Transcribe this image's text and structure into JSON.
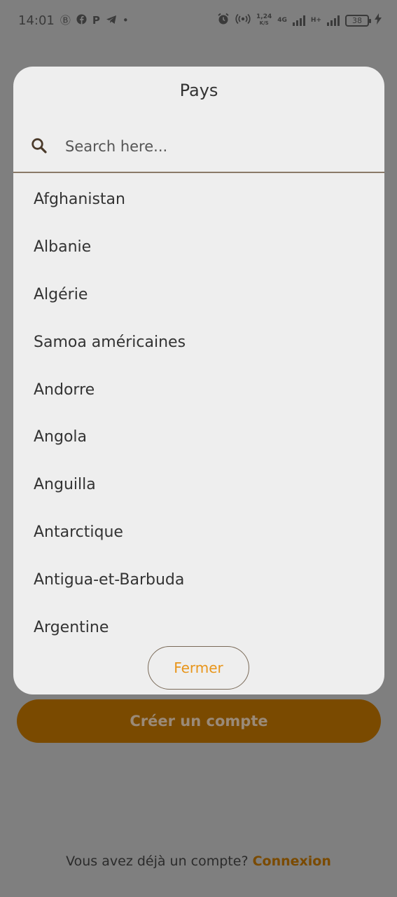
{
  "status_bar": {
    "time": "14:01",
    "notification_icons": [
      "b-circle-icon",
      "facebook-icon",
      "p-icon",
      "telegram-icon",
      "dot-icon"
    ],
    "net_speed_value": "1,24",
    "net_speed_unit": "K/S",
    "network_1": "4G",
    "network_2": "H+",
    "battery": "38"
  },
  "dialog": {
    "title": "Pays",
    "search": {
      "placeholder": "Search here..."
    },
    "countries": [
      "Afghanistan",
      "Albanie",
      "Algérie",
      "Samoa américaines",
      "Andorre",
      "Angola",
      "Anguilla",
      "Antarctique",
      "Antigua-et-Barbuda",
      "Argentine"
    ],
    "close_label": "Fermer"
  },
  "background": {
    "create_account_label": "Créer un compte",
    "login_prompt": "Vous avez déjà un compte?",
    "login_link": "Connexion"
  },
  "colors": {
    "overlay": "#7f7f7f",
    "dialog_bg": "#eeeeee",
    "accent_orange": "#e8951a",
    "brand_brown": "#7a4a00"
  }
}
